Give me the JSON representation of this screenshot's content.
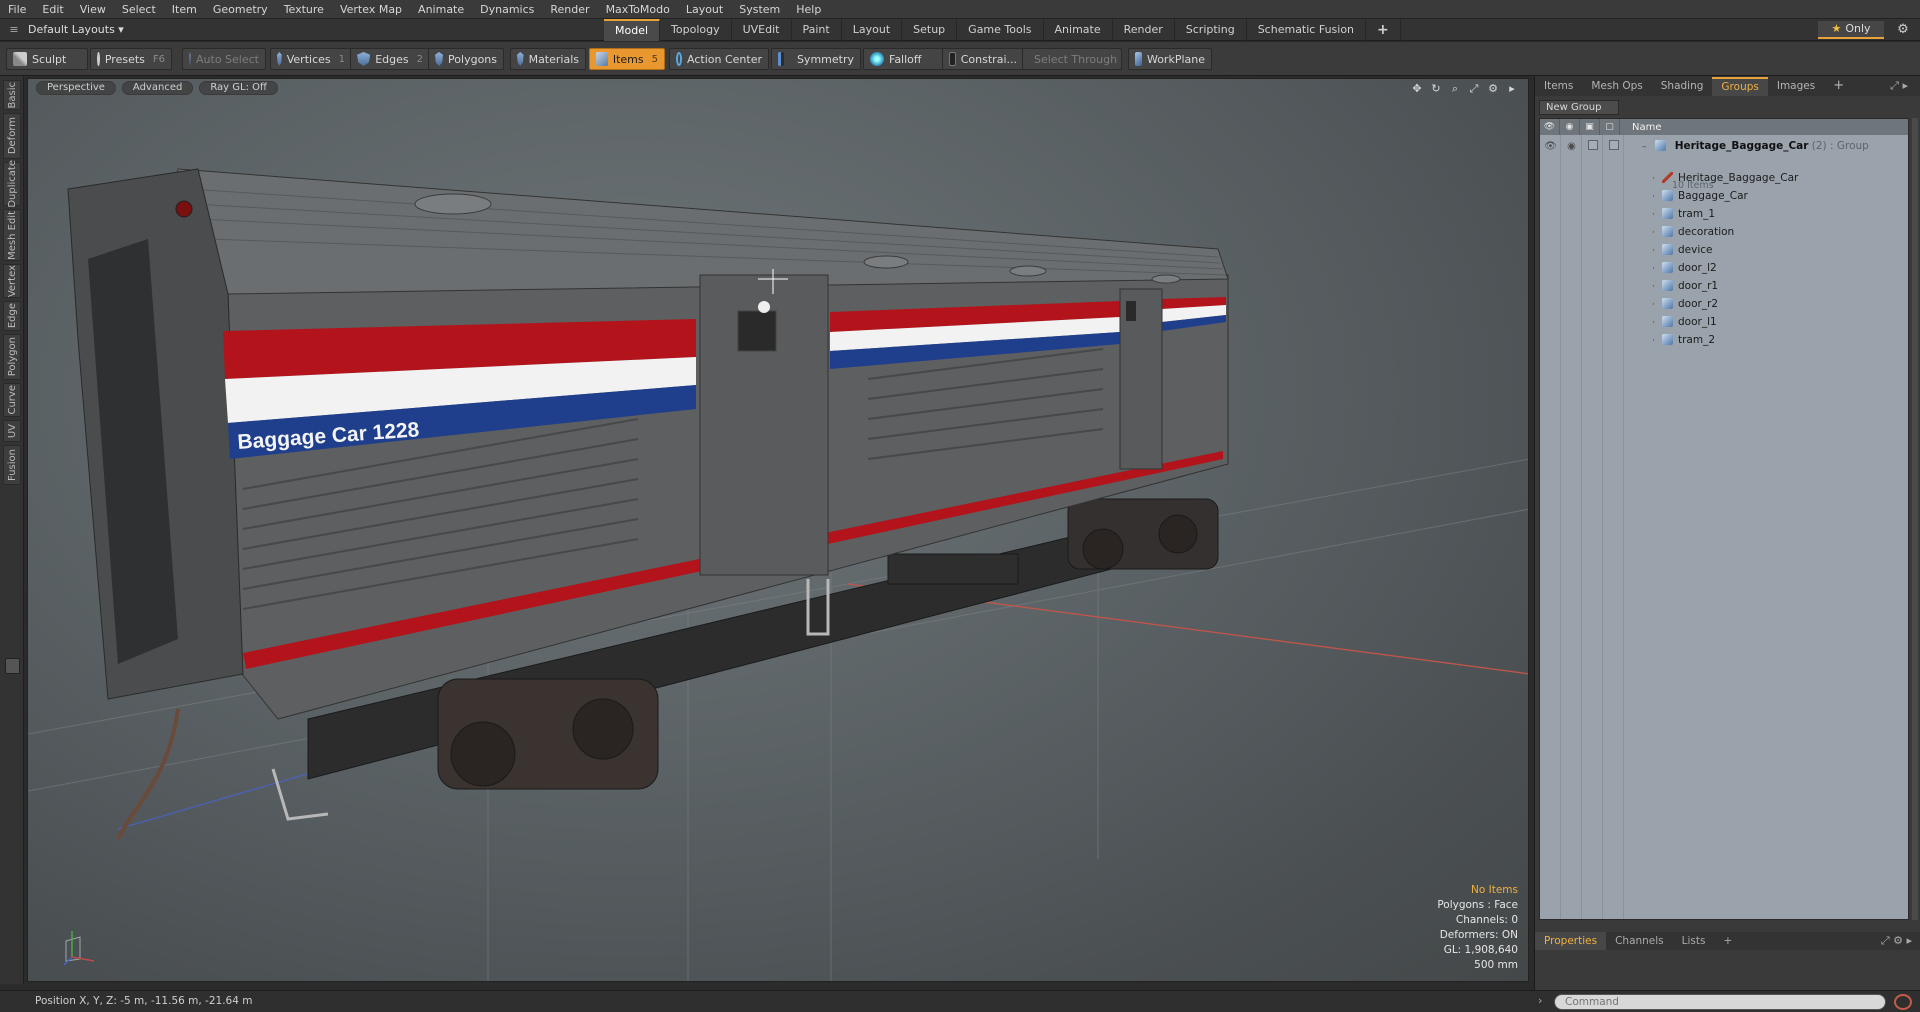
{
  "menu": [
    "File",
    "Edit",
    "View",
    "Select",
    "Item",
    "Geometry",
    "Texture",
    "Vertex Map",
    "Animate",
    "Dynamics",
    "Render",
    "MaxToModo",
    "Layout",
    "System",
    "Help"
  ],
  "layout_selector": "Default Layouts ▾",
  "layout_tabs": [
    "Model",
    "Topology",
    "UVEdit",
    "Paint",
    "Layout",
    "Setup",
    "Game Tools",
    "Animate",
    "Render",
    "Scripting",
    "Schematic Fusion",
    "+"
  ],
  "active_layout_tab": "Model",
  "only_label": "Only",
  "toolbar": {
    "sculpt": "Sculpt",
    "presets": "Presets",
    "presets_key": "F6",
    "auto_select": "Auto Select",
    "vertices": "Vertices",
    "vertices_key": "1",
    "edges": "Edges",
    "edges_key": "2",
    "polygons": "Polygons",
    "materials": "Materials",
    "items": "Items",
    "items_key": "5",
    "action_center": "Action Center",
    "symmetry": "Symmetry",
    "falloff": "Falloff",
    "constraints": "Constrai...",
    "select_through": "Select Through",
    "workplane": "WorkPlane"
  },
  "left_tabs": [
    "Basic",
    "Deform",
    "Duplicate",
    "Mesh Edit",
    "Vertex",
    "Edge",
    "Polygon",
    "Curve",
    "UV",
    "Fusion"
  ],
  "viewport": {
    "view_mode": "Perspective",
    "advanced": "Advanced",
    "ray_gl": "Ray GL: Off",
    "car_label": "Baggage Car 1228",
    "info": {
      "no_items": "No Items",
      "polygons": "Polygons : Face",
      "channels": "Channels: 0",
      "deformers": "Deformers: ON",
      "gl": "GL: 1,908,640",
      "scale": "500 mm"
    }
  },
  "status": {
    "position": "Position X, Y, Z:  -5 m, -11.56 m, -21.64 m",
    "command_placeholder": "Command"
  },
  "right_panel": {
    "tabs": [
      "Items",
      "Mesh Ops",
      "Shading",
      "Groups",
      "Images",
      "+"
    ],
    "active_tab": "Groups",
    "new_group": "New Group",
    "name_header": "Name",
    "group": {
      "name": "Heritage_Baggage_Car",
      "count": "(2)",
      "type": ": Group",
      "items_count": "10 Items"
    },
    "items": [
      "Heritage_Baggage_Car",
      "Baggage_Car",
      "tram_1",
      "decoration",
      "device",
      "door_l2",
      "door_r1",
      "door_r2",
      "door_l1",
      "tram_2"
    ],
    "bottom_tabs": [
      "Properties",
      "Channels",
      "Lists",
      "+"
    ],
    "active_bottom_tab": "Properties"
  },
  "colors": {
    "accent": "#e8a23a",
    "stripe_red": "#b3141b",
    "stripe_white": "#f2f2f2",
    "stripe_blue": "#1f3f8c",
    "car_body": "#5a5a5a"
  }
}
